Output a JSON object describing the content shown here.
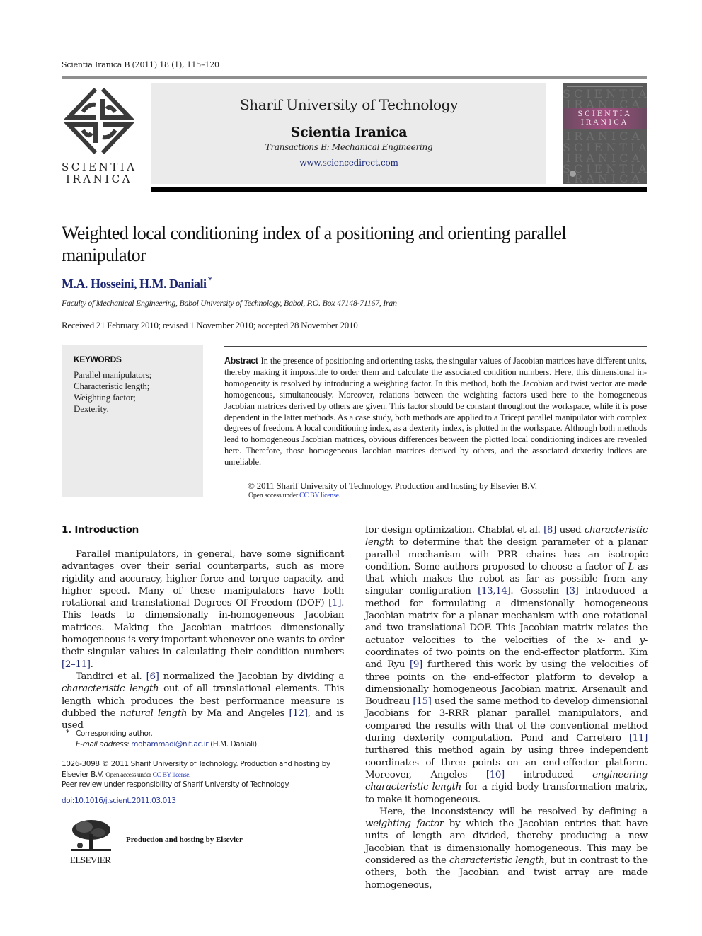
{
  "running_head": "Scientia Iranica B (2011) 18 (1), 115–120",
  "logo": {
    "icon": "scientia-iranica-knot-logo",
    "line1": "SCIENTIA",
    "line2": "IRANICA"
  },
  "banner": {
    "university": "Sharif University of Technology",
    "journal": "Scientia Iranica",
    "transactions": "Transactions B: Mechanical Engineering",
    "url": "www.sciencedirect.com"
  },
  "cover": {
    "ghost_words": [
      "SCIENTIA",
      "IRANICA",
      "SCIENTIA",
      "IRANICA",
      "SCIENTIA",
      "IRANICA",
      "SCIENTIA",
      "IRANICA"
    ],
    "band_line1": "SCIENTIA",
    "band_line2": "IRANICA"
  },
  "article": {
    "title": "Weighted local conditioning index of a positioning and orienting parallel manipulator",
    "authors": "M.A. Hosseini, H.M. Daniali",
    "corresponding_mark": "*",
    "affiliation": "Faculty of Mechanical Engineering, Babol University of Technology, Babol, P.O. Box 47148-71167, Iran",
    "dates": "Received 21 February 2010; revised 1 November 2010; accepted 28 November 2010"
  },
  "keywords": {
    "heading": "KEYWORDS",
    "items": [
      "Parallel manipulators;",
      "Characteristic length;",
      "Weighting factor;",
      "Dexterity."
    ]
  },
  "abstract": {
    "label": "Abstract",
    "text": "In the presence of positioning and orienting tasks, the singular values of Jacobian matrices have different units, thereby making it impossible to order them and calculate the associated condition numbers. Here, this dimensional in-homogeneity is resolved by introducing a weighting factor. In this method, both the Jacobian and twist vector are made homogeneous, simultaneously. Moreover, relations between the weighting factors used here to the homogeneous Jacobian matrices derived by others are given. This factor should be constant throughout the workspace, while it is pose dependent in the latter methods. As a case study, both methods are applied to a Tricept parallel manipulator with complex degrees of freedom. A local conditioning index, as a dexterity index, is plotted in the workspace. Although both methods lead to homogeneous Jacobian matrices, obvious differences between the plotted local conditioning indices are revealed here. Therefore, those homogeneous Jacobian matrices derived by others, and the associated dexterity indices are unreliable.",
    "copyright": "© 2011 Sharif University of Technology. Production and hosting by Elsevier B.V.",
    "open_access_prefix": "Open access under ",
    "license_link": "CC BY license."
  },
  "intro": {
    "heading": "1.  Introduction",
    "p1": {
      "a": "Parallel manipulators, in general, have some significant advantages over their serial counterparts, such as more rigidity and accuracy, higher force and torque capacity, and higher speed. Many of these manipulators have both rotational and translational Degrees Of Freedom (DOF) ",
      "ref1": "[1]",
      "b": ". This leads to dimensionally in-homogeneous Jacobian matrices. Making the Jacobian matrices dimensionally homogeneous is very important whenever one wants to order their singular values in calculating their condition numbers ",
      "ref2": "[2–11]",
      "c": "."
    },
    "p2": {
      "a": "Tandirci et al. ",
      "ref1": "[6]",
      "b": " normalized the Jacobian by dividing a ",
      "i1": "characteristic length",
      "c": " out of all translational elements. This length which produces the best performance measure is dubbed the ",
      "i2": "natural length",
      "d": " by Ma and Angeles ",
      "ref2": "[12]",
      "e": ", and is used"
    },
    "p2_cont": {
      "a": "for design optimization. Chablat et al. ",
      "ref1": "[8]",
      "b": " used ",
      "i1": "characteristic length",
      "c": " to determine that the design parameter of a planar parallel mechanism with PRR chains has an isotropic condition. Some authors proposed to choose a factor of ",
      "i2": "L",
      "d": " as that which makes the robot as far as possible from any singular configuration ",
      "ref2": "[13,14]",
      "e": ". Gosselin ",
      "ref3": "[3]",
      "f": " introduced a method for formulating a dimensionally homogeneous Jacobian matrix for a planar mechanism with one rotational and two translational DOF. This Jacobian matrix relates the actuator velocities to the velocities of the ",
      "i3": "x",
      "g": "- and ",
      "i4": "y",
      "h": "-coordinates of two points on the end-effector platform. Kim and Ryu ",
      "ref4": "[9]",
      "j": " furthered this work by using the velocities of three points on the end-effector platform to develop a dimensionally homogeneous Jacobian matrix. Arsenault and Boudreau ",
      "ref5": "[15]",
      "k": " used the same method to develop dimensional Jacobians for 3-RRR planar parallel manipulators, and compared the results with that of the conventional method during dexterity computation. Pond and Carretero ",
      "ref6": "[11]",
      "l": " furthered this method again by using three independent coordinates of three points on an end-effector platform. Moreover, Angeles ",
      "ref7": "[10]",
      "m": " introduced ",
      "i5": "engineering characteristic length",
      "n": " for a rigid body transformation matrix, to make it homogeneous."
    },
    "p3": {
      "a": "Here, the inconsistency will be resolved by defining a ",
      "i1": "weighting factor",
      "b": " by which the Jacobian entries that have units of length are divided, thereby producing a new Jacobian that is dimensionally homogeneous. This may be considered as the ",
      "i2": "characteristic length",
      "c": ", but in contrast to the others, both the Jacobian and twist array are made homogeneous,"
    }
  },
  "footnotes": {
    "star": "*",
    "corresponding": "Corresponding author.",
    "email_label": "E-mail address:",
    "email": "mohammadi@nit.ac.ir",
    "email_suffix": "(H.M. Daniali).",
    "issn_line": "1026-3098 © 2011 Sharif University of Technology. Production and hosting by",
    "elsevier_bv": "Elsevier B.V.",
    "open_access_prefix": "Open access under ",
    "license_link": "CC BY license.",
    "peer_review_a": "Peer review under responsibility of Sharif",
    "peer_review_b": "University of Technology.",
    "doi": "doi:10.1016/j.scient.2011.03.013"
  },
  "elsevier_box": {
    "logo_name": "ELSEVIER",
    "text": "Production and hosting by Elsevier"
  }
}
